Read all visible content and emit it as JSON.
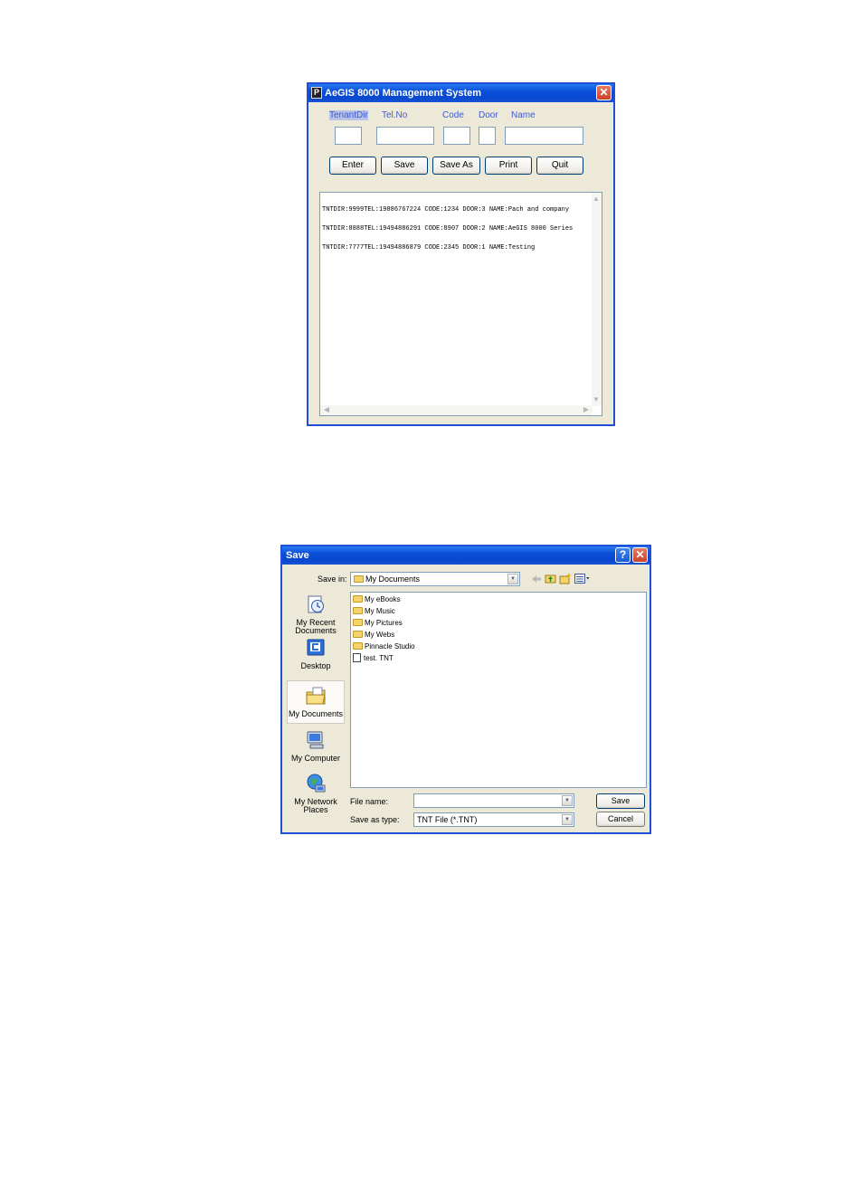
{
  "main_window": {
    "title": "AeGIS 8000 Management System",
    "labels": {
      "tenant_dir": "TenantDir",
      "tel_no": "Tel.No",
      "code": "Code",
      "door": "Door",
      "name": "Name"
    },
    "buttons": {
      "enter": "Enter",
      "save": "Save",
      "save_as": "Save As",
      "print": "Print",
      "quit": "Quit"
    },
    "records": [
      "TNTDIR:9999TEL:19886767224 CODE:1234 DOOR:3 NAME:Pach and company",
      "TNTDIR:8888TEL:19494886291 CODE:8907 DOOR:2 NAME:AeGIS 8000 Series",
      "TNTDIR:7777TEL:19494886879 CODE:2345 DOOR:1 NAME:Testing"
    ]
  },
  "save_dialog": {
    "title": "Save",
    "save_in_label": "Save in:",
    "save_in_value": "My Documents",
    "places": [
      "My Recent Documents",
      "Desktop",
      "My Documents",
      "My Computer",
      "My Network Places"
    ],
    "places_lines": [
      [
        "My Recent",
        "Documents"
      ],
      [
        "Desktop"
      ],
      [
        "My Documents"
      ],
      [
        "My Computer"
      ],
      [
        "My Network",
        "Places"
      ]
    ],
    "items": [
      {
        "name": "My eBooks",
        "type": "folder"
      },
      {
        "name": "My Music",
        "type": "folder"
      },
      {
        "name": "My Pictures",
        "type": "folder"
      },
      {
        "name": "My Webs",
        "type": "folder"
      },
      {
        "name": "Pinnacle Studio",
        "type": "folder"
      },
      {
        "name": "test. TNT",
        "type": "file"
      }
    ],
    "file_name_label": "File name:",
    "file_name_value": "",
    "save_type_label": "Save as type:",
    "save_type_value": "TNT File (*.TNT)",
    "save_button": "Save",
    "cancel_button": "Cancel"
  }
}
